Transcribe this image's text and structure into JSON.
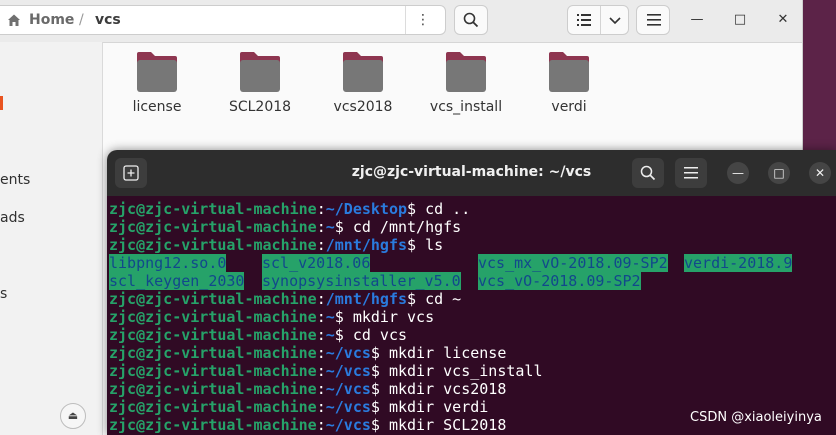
{
  "file_manager": {
    "breadcrumb": {
      "home": "Home",
      "separator": "/",
      "current": "vcs"
    },
    "sidebar": {
      "items": [
        "ents",
        "ads",
        "s"
      ]
    },
    "folders": [
      {
        "label": "license"
      },
      {
        "label": "SCL2018"
      },
      {
        "label": "vcs2018"
      },
      {
        "label": "vcs_install"
      },
      {
        "label": "verdi"
      }
    ],
    "colors": {
      "folder_tab": "#8e3650",
      "folder_body": "#777777"
    }
  },
  "terminal": {
    "title": "zjc@zjc-virtual-machine: ~/vcs",
    "lines": [
      {
        "user": "zjc@zjc-virtual-machine",
        "path": "~/Desktop",
        "cmd": " cd .."
      },
      {
        "user": "zjc@zjc-virtual-machine",
        "path": "~",
        "cmd": " cd /mnt/hgfs"
      },
      {
        "user": "zjc@zjc-virtual-machine",
        "path": "/mnt/hgfs",
        "cmd": " ls"
      },
      {
        "user": "zjc@zjc-virtual-machine",
        "path": "/mnt/hgfs",
        "cmd": " cd ~"
      },
      {
        "user": "zjc@zjc-virtual-machine",
        "path": "~",
        "cmd": " mkdir vcs"
      },
      {
        "user": "zjc@zjc-virtual-machine",
        "path": "~",
        "cmd": " cd vcs"
      },
      {
        "user": "zjc@zjc-virtual-machine",
        "path": "~/vcs",
        "cmd": " mkdir license"
      },
      {
        "user": "zjc@zjc-virtual-machine",
        "path": "~/vcs",
        "cmd": " mkdir vcs_install"
      },
      {
        "user": "zjc@zjc-virtual-machine",
        "path": "~/vcs",
        "cmd": " mkdir vcs2018"
      },
      {
        "user": "zjc@zjc-virtual-machine",
        "path": "~/vcs",
        "cmd": " mkdir verdi"
      },
      {
        "user": "zjc@zjc-virtual-machine",
        "path": "~/vcs",
        "cmd": " mkdir SCL2018"
      }
    ],
    "ls_output": [
      "libpng12.so.0",
      "scl_v2018.06",
      "vcs_mx_vO-2018.09-SP2",
      "verdi-2018.9",
      "scl_keygen_2030",
      "synopsysinstaller_v5.0",
      "vcs_vO-2018.09-SP2"
    ],
    "colors": {
      "background": "#300a24",
      "user": "#26a269",
      "path": "#2a7bde",
      "dir_highlight": "#26a269",
      "dir_text": "#12488b"
    }
  },
  "watermark": "CSDN @xiaoleiyinya"
}
